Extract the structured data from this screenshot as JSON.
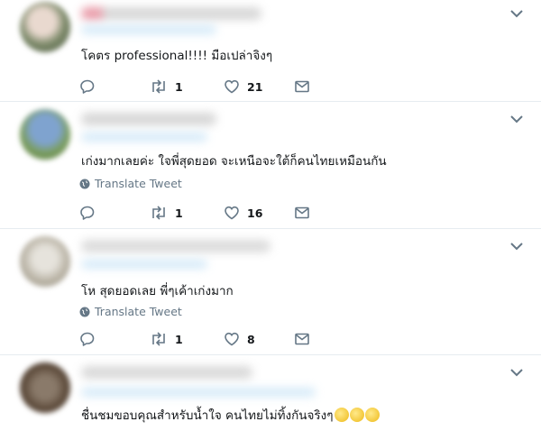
{
  "tweets": [
    {
      "text": "โคตร professional!!!! มือเปล่าจิงๆ",
      "translate_label": "",
      "replies": "",
      "retweets": "1",
      "likes": "21"
    },
    {
      "text": "เก่งมากเลยค่ะ ใจพี่สุดยอด จะเหนือจะใต้ก็คนไทยเหมือนกัน",
      "translate_label": "Translate Tweet",
      "replies": "",
      "retweets": "1",
      "likes": "16"
    },
    {
      "text": "โห สุดยอดเลย พี่ๆเค้าเก่งมาก",
      "translate_label": "Translate Tweet",
      "replies": "",
      "retweets": "1",
      "likes": "8"
    },
    {
      "text": "ชื่นชมขอบคุณสำหรับน้ำใจ คนไทยไม่ทิ้งกันจริงๆ",
      "translate_label": "",
      "replies": "",
      "retweets": "",
      "likes": ""
    }
  ],
  "icons": {
    "reply": "reply-icon",
    "retweet": "retweet-icon",
    "like": "heart-icon",
    "dm": "mail-icon",
    "more": "chevron-down-icon",
    "globe": "globe-icon",
    "clap": "clapping-hands-emoji"
  },
  "colors": {
    "icon": "#657786",
    "divider": "#e6ecf0",
    "link_blur": "#c7e3f6"
  }
}
